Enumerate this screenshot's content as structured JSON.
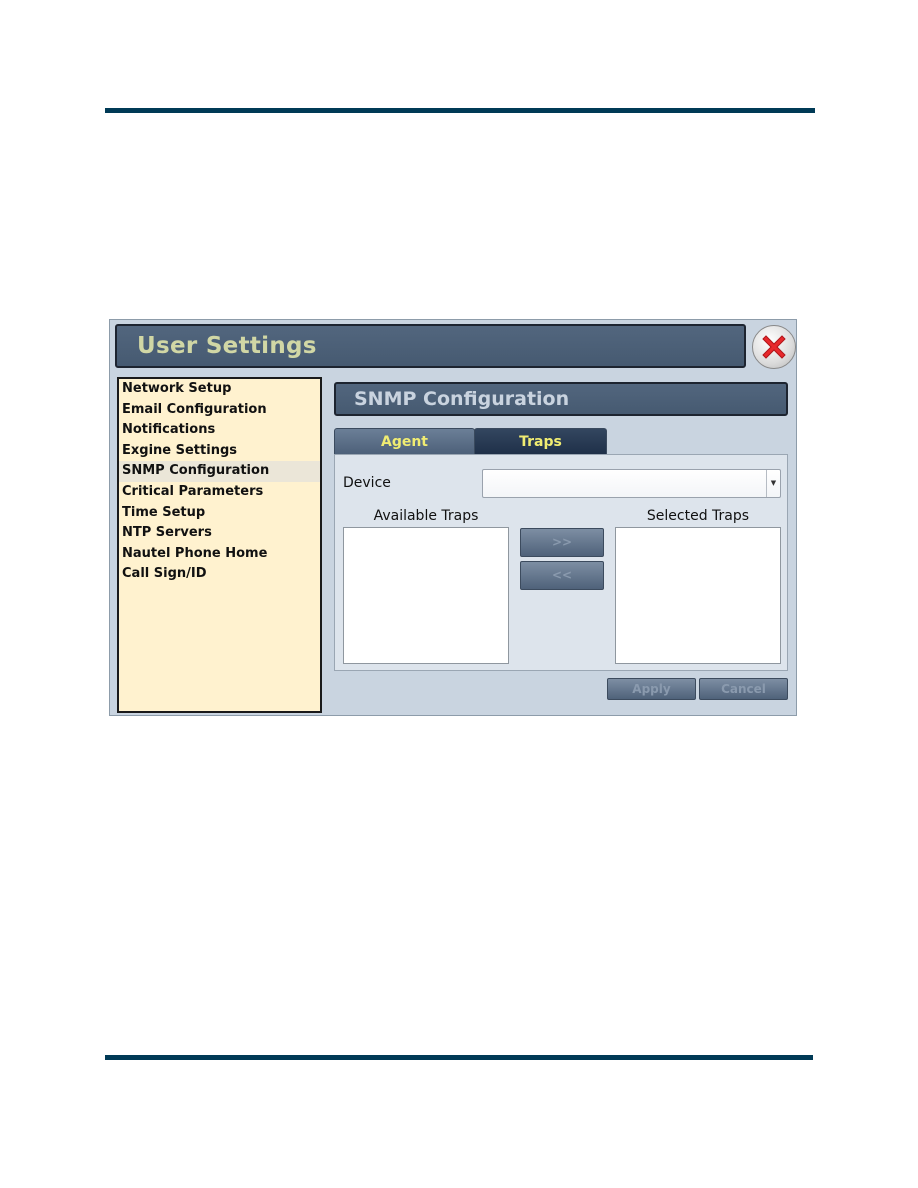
{
  "window": {
    "title": "User Settings",
    "close_icon": "close-x-icon"
  },
  "sidebar": {
    "active_index": 4,
    "items": [
      {
        "label": "Network Setup"
      },
      {
        "label": "Email Configuration"
      },
      {
        "label": "Notifications"
      },
      {
        "label": "Exgine Settings"
      },
      {
        "label": "SNMP Configuration"
      },
      {
        "label": "Critical Parameters"
      },
      {
        "label": "Time Setup"
      },
      {
        "label": "NTP Servers"
      },
      {
        "label": "Nautel Phone Home"
      },
      {
        "label": "Call Sign/ID"
      }
    ]
  },
  "main": {
    "section_title": "SNMP Configuration",
    "tabs": [
      {
        "label": "Agent",
        "active": false
      },
      {
        "label": "Traps",
        "active": true
      }
    ],
    "device": {
      "label": "Device",
      "value": "",
      "dropdown_icon": "chevron-down-icon"
    },
    "available_traps": {
      "label": "Available Traps",
      "items": []
    },
    "selected_traps": {
      "label": "Selected Traps",
      "items": []
    },
    "buttons": {
      "add": ">>",
      "remove": "<<",
      "apply": "Apply",
      "cancel": "Cancel"
    }
  },
  "colors": {
    "rule": "#003a56",
    "title_text": "#d1d7a5",
    "tab_text": "#f0ec72",
    "sidebar_bg": "#fff2cf",
    "header_bg": "#4c6077"
  }
}
